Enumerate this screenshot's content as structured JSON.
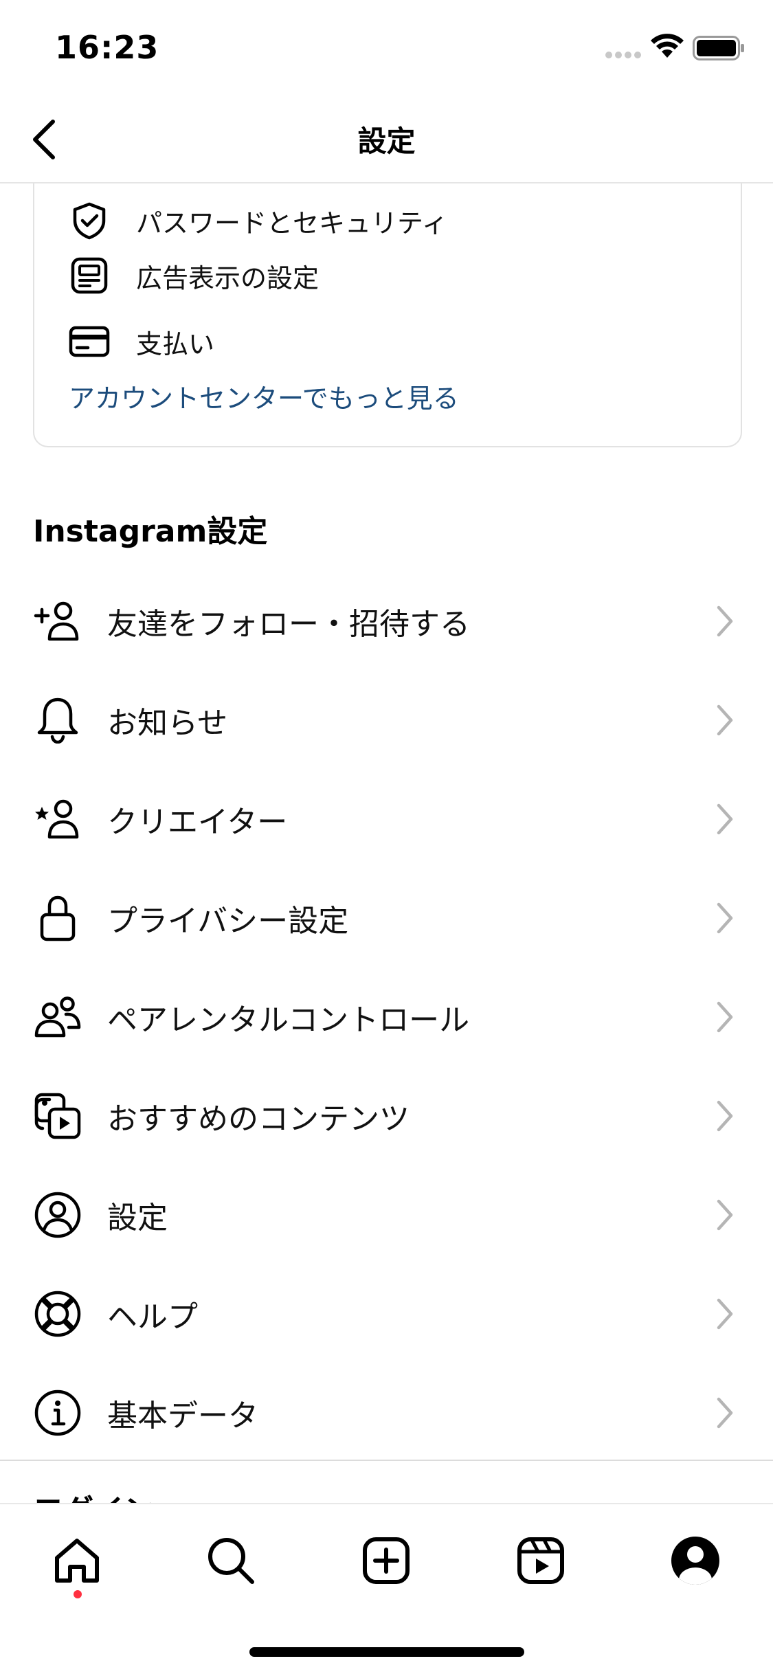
{
  "status_bar": {
    "time": "16:23"
  },
  "header": {
    "title": "設定"
  },
  "account_card": {
    "items": [
      {
        "label": "パスワードとセキュリティ",
        "icon": "shield-check-icon"
      },
      {
        "label": "広告表示の設定",
        "icon": "ad-settings-icon"
      },
      {
        "label": "支払い",
        "icon": "credit-card-icon"
      }
    ],
    "more_link": "アカウントセンターでもっと見る"
  },
  "instagram_section": {
    "heading": "Instagram設定",
    "items": [
      {
        "label": "友達をフォロー・招待する",
        "icon": "add-person-icon"
      },
      {
        "label": "お知らせ",
        "icon": "bell-icon"
      },
      {
        "label": "クリエイター",
        "icon": "star-person-icon"
      },
      {
        "label": "プライバシー設定",
        "icon": "lock-icon"
      },
      {
        "label": "ペアレンタルコントロール",
        "icon": "people-icon"
      },
      {
        "label": "おすすめのコンテンツ",
        "icon": "media-play-icon"
      },
      {
        "label": "設定",
        "icon": "account-circle-icon"
      },
      {
        "label": "ヘルプ",
        "icon": "lifebuoy-icon"
      },
      {
        "label": "基本データ",
        "icon": "info-icon"
      }
    ]
  },
  "next_section_peek": "ログイン",
  "tabbar": {
    "items": [
      "home-icon",
      "search-icon",
      "create-icon",
      "reels-icon",
      "profile-icon"
    ],
    "active": "home-icon",
    "notification_dot_color": "#ff3040"
  },
  "colors": {
    "link": "#1c4c7c",
    "divider": "#dcdcdc"
  }
}
